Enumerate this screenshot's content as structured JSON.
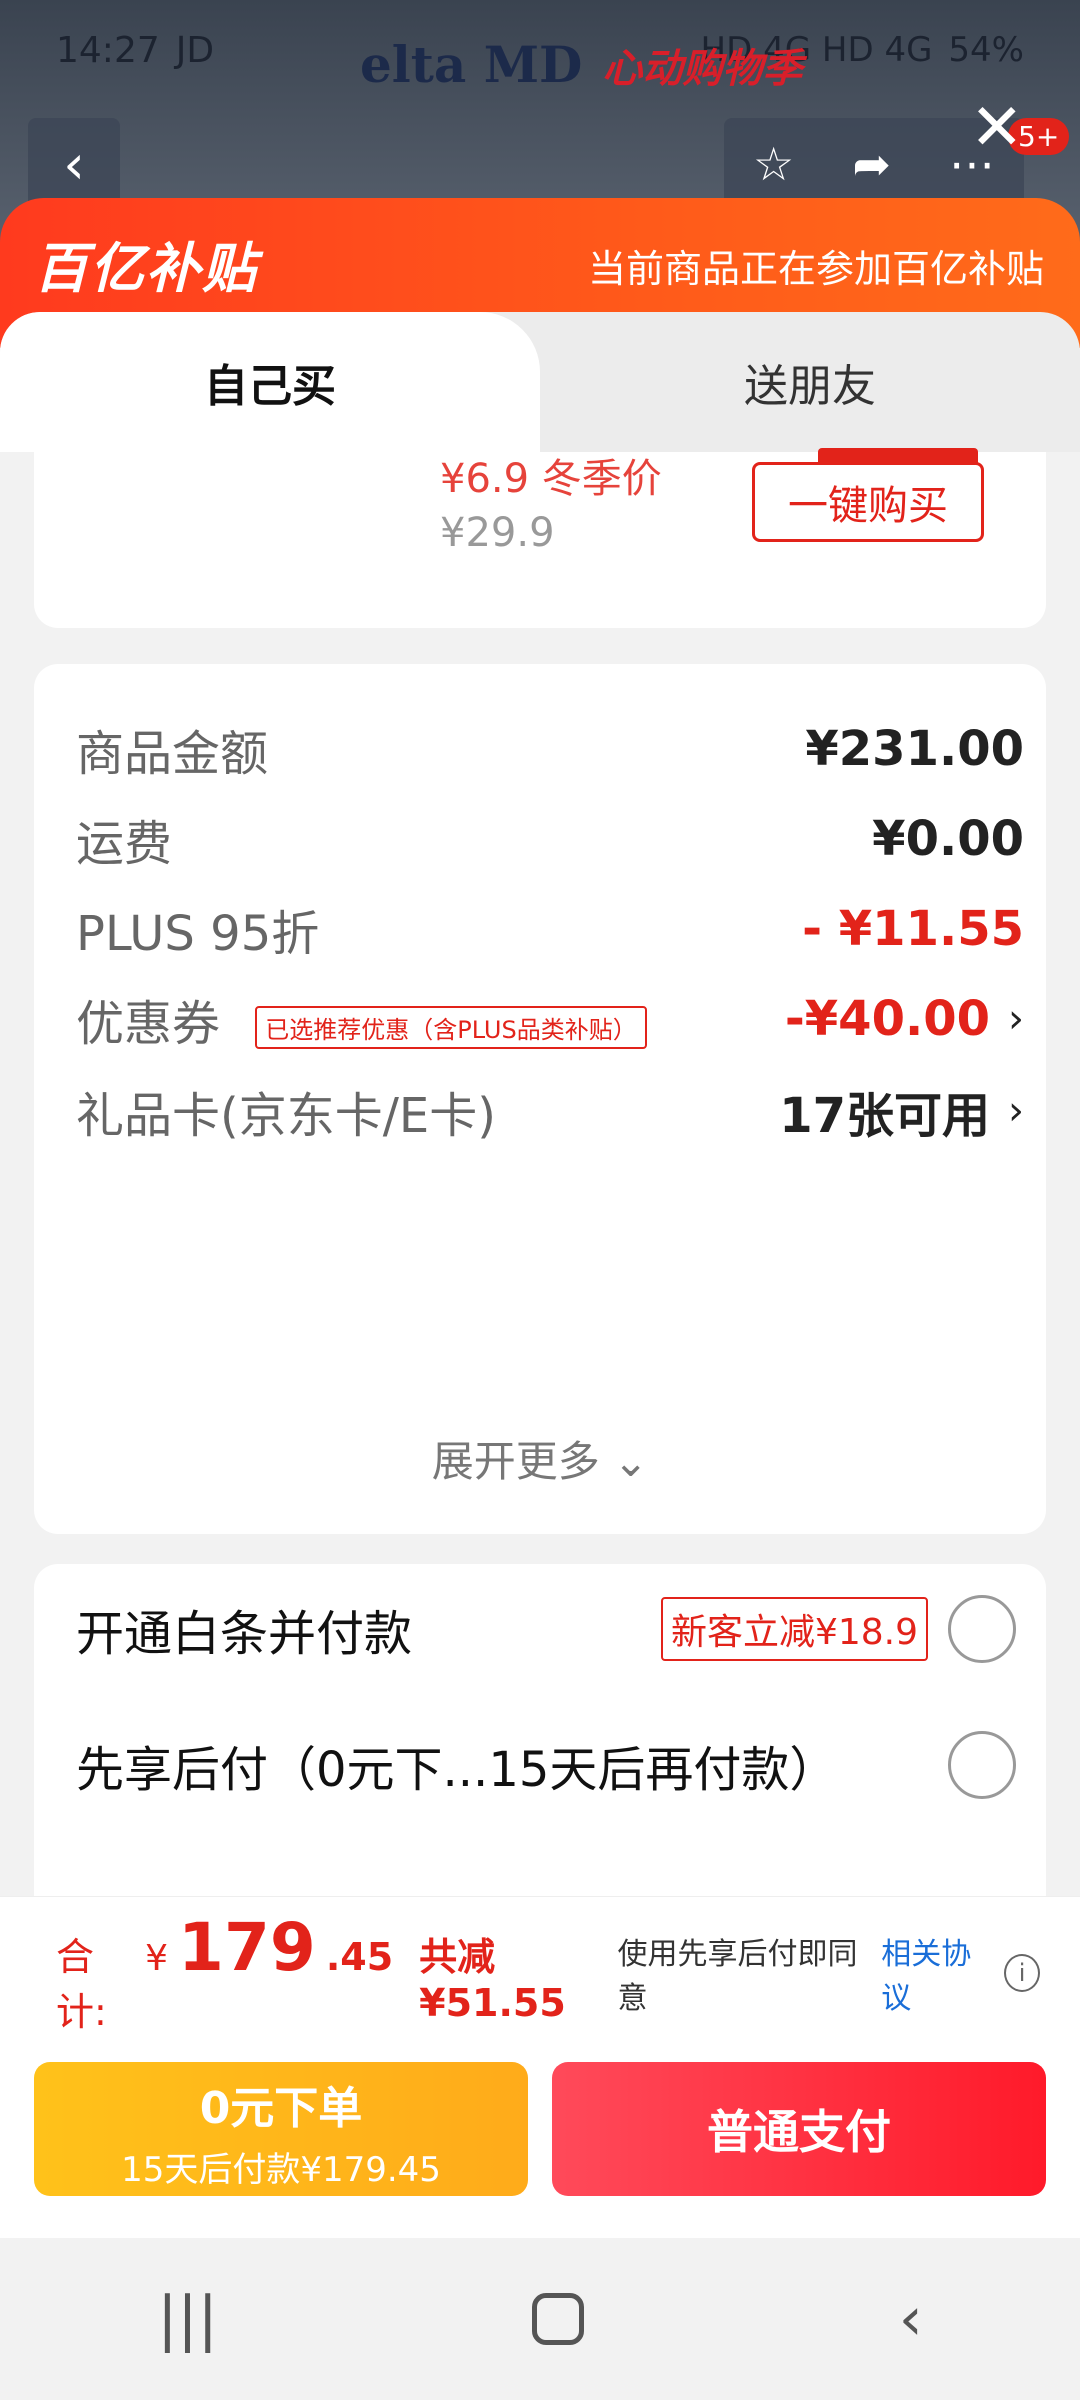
{
  "status_bar": {
    "time": "14:27",
    "app_icons": "JD",
    "network": "HD 4G HD 4G",
    "battery": "54%"
  },
  "background_header": {
    "brand_name": "elta MD",
    "campaign": "心动购物季",
    "badge": "5+"
  },
  "banner": {
    "logo_text": "百亿补贴",
    "notice": "当前商品正在参加百亿补贴"
  },
  "tabs": [
    {
      "label": "自己买",
      "active": true
    },
    {
      "label": "送朋友",
      "active": false
    }
  ],
  "product_card": {
    "promo_price": "¥6.9 冬季价",
    "original_price": "¥29.9",
    "buy_button": "一键购买"
  },
  "amounts": {
    "goods_label": "商品金额",
    "goods_value": "¥231.00",
    "shipping_label": "运费",
    "shipping_value": "¥0.00",
    "plus_label": "PLUS 95折",
    "plus_value": "- ¥11.55",
    "coupon_label": "优惠券",
    "coupon_tag": "已选推荐优惠（含PLUS品类补贴）",
    "coupon_value": "-¥40.00",
    "giftcard_label": "礼品卡(京东卡/E卡)",
    "giftcard_value": "17张可用",
    "expand_label": "展开更多"
  },
  "payment_options": {
    "baitiao_label": "开通白条并付款",
    "baitiao_tag": "新客立减¥18.9",
    "later_label": "先享后付（0元下...15天后再付款）"
  },
  "total": {
    "label": "合计:",
    "currency": "¥",
    "integer": "179",
    "decimal": ".45",
    "saved": "共减¥51.55",
    "agree_text": "使用先享后付即同意",
    "agree_link": "相关协议"
  },
  "buttons": {
    "zero_main": "0元下单",
    "zero_sub": "15天后付款¥179.45",
    "normal_pay": "普通支付"
  },
  "colors": {
    "accent_red": "#e2231a",
    "banner_orange": "#ff4a1e",
    "zero_yellow": "#ffb81a",
    "link_blue": "#1a6ed8"
  }
}
